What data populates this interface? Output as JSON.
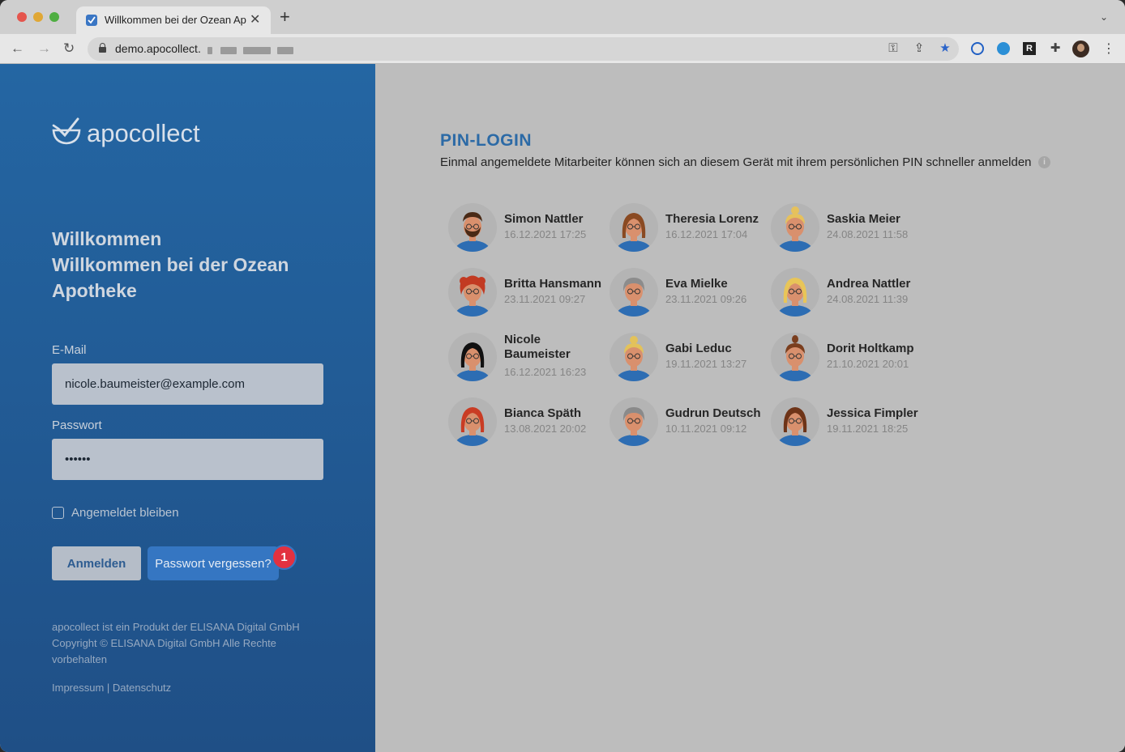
{
  "browser": {
    "tab_title": "Willkommen bei der Ozean Apotheke",
    "tab_close": "✕",
    "new_tab": "+",
    "url": "demo.apocollect."
  },
  "brand": {
    "name": "apocollect"
  },
  "welcome": {
    "line1": "Willkommen",
    "line2": "Willkommen bei der Ozean",
    "line3": "Apotheke"
  },
  "form": {
    "email_label": "E-Mail",
    "email_value": "nicole.baumeister@example.com",
    "password_label": "Passwort",
    "password_value": "••••••",
    "remember_label": "Angemeldet bleiben",
    "login_button": "Anmelden",
    "forgot_button": "Passwort vergessen?",
    "badge": "1"
  },
  "footer": {
    "text": "apocollect ist ein Produkt der ELISANA Digital GmbH Copyright © ELISANA Digital GmbH Alle Rechte vorbehalten",
    "impressum": "Impressum",
    "separator": " | ",
    "datenschutz": "Datenschutz"
  },
  "pin": {
    "title": "PIN-LOGIN",
    "subtitle": "Einmal angemeldete Mitarbeiter können sich an diesem Gerät mit ihrem persönlichen PIN schneller anmelden",
    "info": "i"
  },
  "users": [
    {
      "name": "Simon Nattler",
      "date": "16.12.2021 17:25",
      "hair": "#4a2a16",
      "style": "beard"
    },
    {
      "name": "Theresia Lorenz",
      "date": "16.12.2021 17:04",
      "hair": "#8a4a22",
      "style": "long"
    },
    {
      "name": "Saskia Meier",
      "date": "24.08.2021 11:58",
      "hair": "#e6c15c",
      "style": "bun"
    },
    {
      "name": "Britta Hansmann",
      "date": "23.11.2021 09:27",
      "hair": "#c23a22",
      "style": "curly"
    },
    {
      "name": "Eva Mielke",
      "date": "23.11.2021 09:26",
      "hair": "#8c8c8c",
      "style": "short"
    },
    {
      "name": "Andrea Nattler",
      "date": "24.08.2021 11:39",
      "hair": "#e8c558",
      "style": "long"
    },
    {
      "name": "Nicole Baumeister",
      "date": "16.12.2021 16:23",
      "hair": "#111111",
      "style": "long"
    },
    {
      "name": "Gabi Leduc",
      "date": "19.11.2021 13:27",
      "hair": "#e3c25a",
      "style": "bun"
    },
    {
      "name": "Dorit Holtkamp",
      "date": "21.10.2021 20:01",
      "hair": "#7a3e1e",
      "style": "topknot"
    },
    {
      "name": "Bianca Späth",
      "date": "13.08.2021 20:02",
      "hair": "#c93c24",
      "style": "long"
    },
    {
      "name": "Gudrun Deutsch",
      "date": "10.11.2021 09:12",
      "hair": "#8a8a8a",
      "style": "short"
    },
    {
      "name": "Jessica Fimpler",
      "date": "19.11.2021 18:25",
      "hair": "#6e3418",
      "style": "long"
    }
  ],
  "colors": {
    "sidebar_top": "#2466a3",
    "sidebar_bottom": "#1f4f86",
    "accent": "#2c6aa6",
    "forgot_button": "#3576c2",
    "badge": "#e23140",
    "overlay_bg": "#bdbdbd",
    "skin": "#d9906d",
    "shirt": "#2d6db3"
  }
}
